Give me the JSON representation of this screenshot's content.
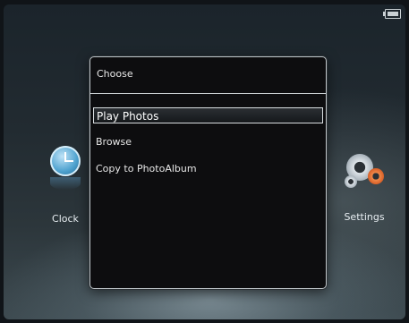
{
  "dialog": {
    "title": "Choose",
    "items": [
      {
        "label": "Play Photos",
        "selected": true
      },
      {
        "label": "Browse",
        "selected": false
      },
      {
        "label": "Copy to PhotoAlbum",
        "selected": false
      }
    ]
  },
  "side": {
    "left": {
      "label": "Clock",
      "icon": "clock-icon"
    },
    "right": {
      "label": "Settings",
      "icon": "gear-icon"
    }
  },
  "status": {
    "battery_icon": "battery-icon"
  },
  "colors": {
    "accent": "#4ea2cf",
    "dialog_bg": "#0d0d0f",
    "border": "#c8cdd0"
  }
}
